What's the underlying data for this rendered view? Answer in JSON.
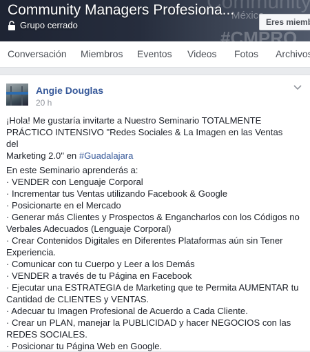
{
  "group": {
    "title": "Community Managers Profesiona...",
    "status": "Grupo cerrado",
    "member_button": "Eres miembro",
    "background_text": "Community Managers P",
    "background_location": "México",
    "background_tag": "#CMPRO"
  },
  "tabs": [
    {
      "label": "Conversación"
    },
    {
      "label": "Miembros"
    },
    {
      "label": "Eventos"
    },
    {
      "label": "Videos"
    },
    {
      "label": "Fotos"
    },
    {
      "label": "Archivos"
    }
  ],
  "post": {
    "author": "Angie Douglas",
    "time": "20 h",
    "intro_lines": [
      "¡Hola! Me gustaría invitarte a Nuestro Seminario TOTALMENTE",
      "PRÁCTICO INTENSIVO \"Redes Sociales & La Imagen en las Ventas del",
      "Marketing 2.0\" en"
    ],
    "hashtag": "#Guadalajara",
    "heading": "En este Seminario aprenderás a:",
    "items": [
      "· VENDER con Lenguaje Corporal",
      "· Incrementar tus Ventas utilizando Facebook & Google",
      "· Posicionarte en el Mercado",
      "· Generar más Clientes y Prospectos & Engancharlos con los Códigos no",
      "Verbales Adecuados (Lenguaje Corporal)",
      "· Crear Contenidos Digitales en Diferentes Plataformas aún sin Tener",
      "Experiencia.",
      "· Comunicar con tu Cuerpo y Leer a los Demás",
      "· VENDER a través de tu Página en Facebook",
      "· Ejecutar una ESTRATEGIA de Marketing que te Permita AUMENTAR tu",
      "Cantidad de CLIENTES y VENTAS.",
      "· Adecuar tu Imagen Profesional de Acuerdo a Cada Cliente.",
      "· Crear un PLAN, manejar la PUBLICIDAD y hacer NEGOCIOS con las",
      "REDES SOCIALES.",
      "· Posicionar tu Página Web en Google."
    ]
  }
}
